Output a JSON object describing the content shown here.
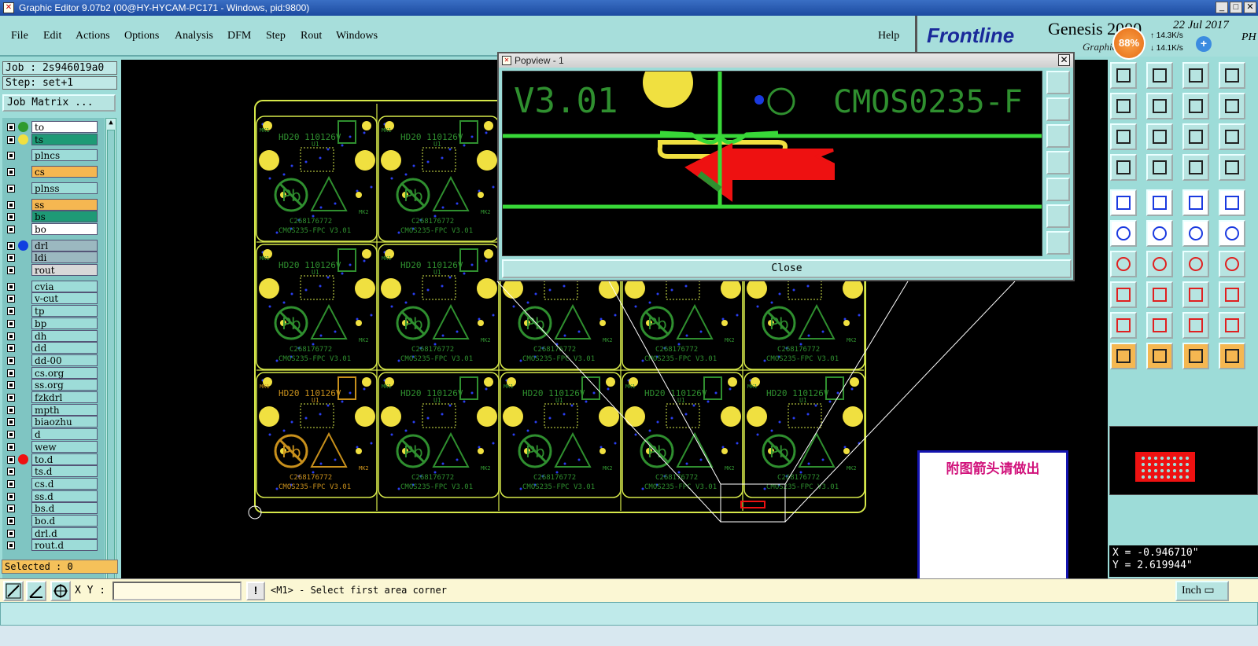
{
  "window": {
    "title": "Graphic Editor 9.07b2 (00@HY-HYCAM-PC171 - Windows, pid:9800)"
  },
  "menu": {
    "items": [
      "File",
      "Edit",
      "Actions",
      "Options",
      "Analysis",
      "DFM",
      "Step",
      "Rout",
      "Windows"
    ],
    "help": "Help"
  },
  "brand": {
    "logo": "Frontline",
    "product": "Genesis 2000",
    "subtitle": "Graphic Ed",
    "date": "22 Jul 2017",
    "time_suffix": "PH"
  },
  "network_widget": {
    "cpu": "88%",
    "up": "14.3K/s",
    "down": "14.1K/s"
  },
  "left_panel": {
    "job": "Job : 2s946019a0",
    "step": "Step: set+1",
    "job_matrix": "Job Matrix ...",
    "selected": "Selected : 0",
    "layers": [
      {
        "name": "to",
        "color": "#ffffff",
        "dot": "#2f9a2f"
      },
      {
        "name": "ts",
        "color": "#1e9a76",
        "dot": "#f0e040"
      },
      {
        "name": "plncs",
        "color": "#9ddcd8",
        "dot": ""
      },
      {
        "name": "cs",
        "color": "#f5b751",
        "dot": ""
      },
      {
        "name": "plnss",
        "color": "#9ddcd8",
        "dot": ""
      },
      {
        "name": "ss",
        "color": "#f5b751",
        "dot": ""
      },
      {
        "name": "bs",
        "color": "#1e9a76",
        "dot": ""
      },
      {
        "name": "bo",
        "color": "#ffffff",
        "dot": ""
      },
      {
        "name": "drl",
        "color": "#9bb8c0",
        "dot": "#1040e0"
      },
      {
        "name": "ldi",
        "color": "#9bb8c0",
        "dot": ""
      },
      {
        "name": "rout",
        "color": "#d8d8d8",
        "dot": ""
      },
      {
        "name": "cvia",
        "color": "#9ddcd8",
        "dot": ""
      },
      {
        "name": "v-cut",
        "color": "#9ddcd8",
        "dot": ""
      },
      {
        "name": "tp",
        "color": "#9ddcd8",
        "dot": ""
      },
      {
        "name": "bp",
        "color": "#9ddcd8",
        "dot": ""
      },
      {
        "name": "dh",
        "color": "#9ddcd8",
        "dot": ""
      },
      {
        "name": "dd",
        "color": "#9ddcd8",
        "dot": ""
      },
      {
        "name": "dd-00",
        "color": "#9ddcd8",
        "dot": ""
      },
      {
        "name": "cs.org",
        "color": "#9ddcd8",
        "dot": ""
      },
      {
        "name": "ss.org",
        "color": "#9ddcd8",
        "dot": ""
      },
      {
        "name": "fzkdrl",
        "color": "#9ddcd8",
        "dot": ""
      },
      {
        "name": "mpth",
        "color": "#9ddcd8",
        "dot": ""
      },
      {
        "name": "biaozhu",
        "color": "#9ddcd8",
        "dot": ""
      },
      {
        "name": "d",
        "color": "#9ddcd8",
        "dot": ""
      },
      {
        "name": "wew",
        "color": "#9ddcd8",
        "dot": ""
      },
      {
        "name": "to.d",
        "color": "#9ddcd8",
        "dot": "#ee1111"
      },
      {
        "name": "ts.d",
        "color": "#9ddcd8",
        "dot": ""
      },
      {
        "name": "cs.d",
        "color": "#9ddcd8",
        "dot": ""
      },
      {
        "name": "ss.d",
        "color": "#9ddcd8",
        "dot": ""
      },
      {
        "name": "bs.d",
        "color": "#9ddcd8",
        "dot": ""
      },
      {
        "name": "bo.d",
        "color": "#9ddcd8",
        "dot": ""
      },
      {
        "name": "drl.d",
        "color": "#9ddcd8",
        "dot": ""
      },
      {
        "name": "rout.d",
        "color": "#9ddcd8",
        "dot": ""
      }
    ]
  },
  "board": {
    "label_top": "HD20 110126V",
    "label_u1": "U1",
    "label_mk1": "MK1",
    "label_mk2": "MK2",
    "code": "C268176772",
    "part": "CMOS235-FPC V3.01",
    "pb": "Pb"
  },
  "popview": {
    "title": "Popview - 1",
    "close_label": "Close",
    "text_version": "V3.01",
    "text_part": "CMOS0235-F"
  },
  "note": {
    "text": "附图箭头请做出"
  },
  "coords": {
    "x": "X = -0.946710\"",
    "y": "Y = 2.619944\""
  },
  "bottom": {
    "xy_label": "X Y :",
    "xy_value": "",
    "warn": "!",
    "prompt": "<M1> - Select first area corner",
    "units": "Inch"
  },
  "colors": {
    "panel": "#9ddcd8",
    "pcb_green": "#2f8f2f",
    "pad_yellow": "#f0e040",
    "trace_green": "#38d838",
    "highlight_red": "#ee1111"
  }
}
